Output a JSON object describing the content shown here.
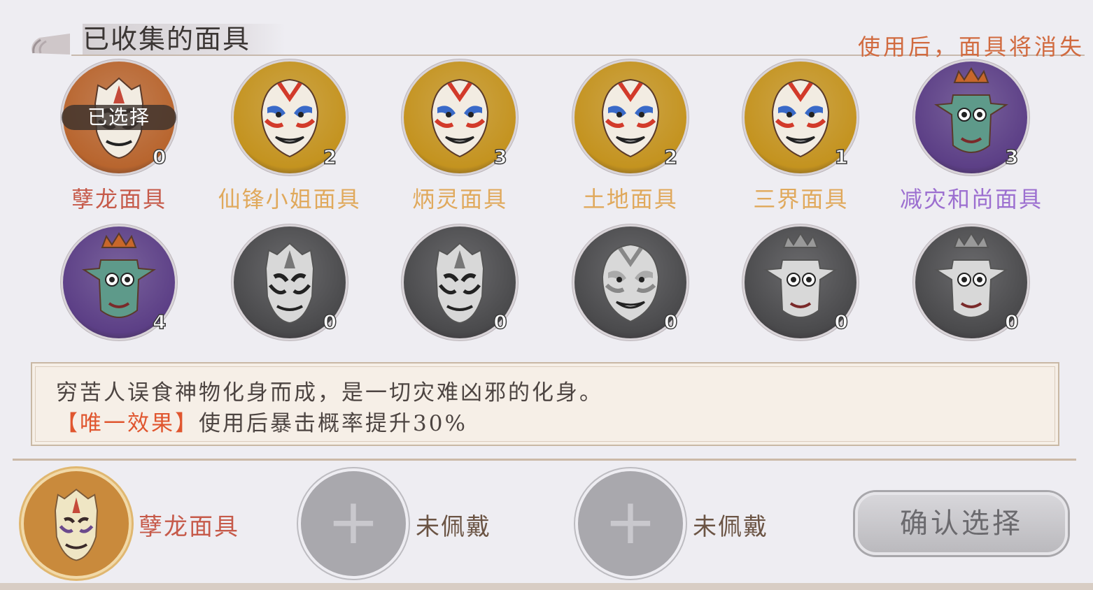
{
  "header": {
    "title": "已收集的面具",
    "hint": "使用后，面具将消失"
  },
  "masks": [
    {
      "name": "孽龙面具",
      "count": "0",
      "selected": true,
      "bg": "#b8652e",
      "name_color": "#c65a4a",
      "face": "dragon"
    },
    {
      "name": "仙锋小姐面具",
      "count": "2",
      "selected": false,
      "bg": "#c4931f",
      "name_color": "#e0a95c",
      "face": "red"
    },
    {
      "name": "炳灵面具",
      "count": "3",
      "selected": false,
      "bg": "#c4931f",
      "name_color": "#e0a95c",
      "face": "red"
    },
    {
      "name": "土地面具",
      "count": "2",
      "selected": false,
      "bg": "#c4931f",
      "name_color": "#e0a95c",
      "face": "red"
    },
    {
      "name": "三界面具",
      "count": "1",
      "selected": false,
      "bg": "#c4931f",
      "name_color": "#e0a95c",
      "face": "red"
    },
    {
      "name": "减灾和尚面具",
      "count": "3",
      "selected": false,
      "bg": "#5c3f86",
      "name_color": "#9c6fd0",
      "face": "monk"
    },
    {
      "name": "",
      "count": "4",
      "selected": false,
      "bg": "#5c3f86",
      "name_color": "#9c6fd0",
      "face": "monk"
    },
    {
      "name": "",
      "count": "0",
      "selected": false,
      "bg": "#4a4a4c",
      "name_color": "#888",
      "face": "dragon-gray"
    },
    {
      "name": "",
      "count": "0",
      "selected": false,
      "bg": "#4a4a4c",
      "name_color": "#888",
      "face": "dragon-gray"
    },
    {
      "name": "",
      "count": "0",
      "selected": false,
      "bg": "#4a4a4c",
      "name_color": "#888",
      "face": "red-gray"
    },
    {
      "name": "",
      "count": "0",
      "selected": false,
      "bg": "#4a4a4c",
      "name_color": "#888",
      "face": "monk-gray"
    },
    {
      "name": "",
      "count": "0",
      "selected": false,
      "bg": "#4a4a4c",
      "name_color": "#888",
      "face": "monk-gray"
    }
  ],
  "selected_tag": "已选择",
  "description": {
    "line1": "穷苦人误食神物化身而成，是一切灾难凶邪的化身。",
    "tag": "【唯一效果】",
    "effect": "使用后暴击概率提升30%"
  },
  "slots": [
    {
      "label": "孽龙面具",
      "color": "#c65a4a",
      "filled": true
    },
    {
      "label": "未佩戴",
      "color": "#6b5444",
      "filled": false
    },
    {
      "label": "未佩戴",
      "color": "#6b5444",
      "filled": false
    }
  ],
  "confirm_label": "确认选择"
}
